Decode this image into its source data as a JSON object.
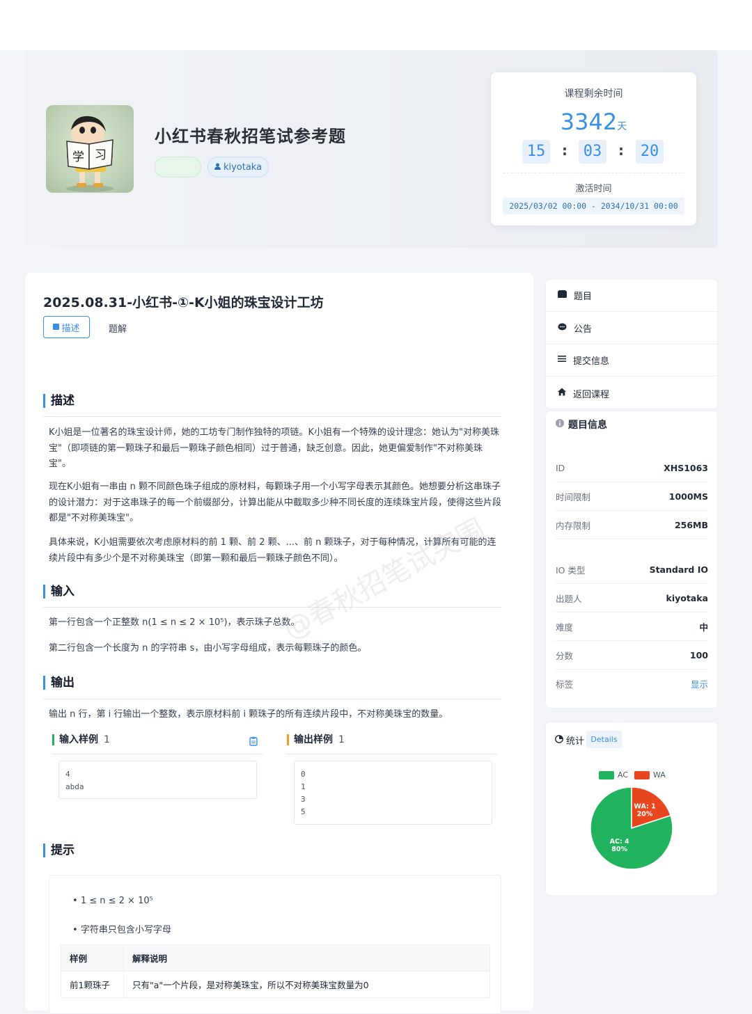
{
  "course": {
    "title": "小红书春秋招笔试参考题",
    "author": "kiyotaka"
  },
  "timer": {
    "label": "课程剩余时间",
    "days": "3342",
    "days_unit": "天",
    "hours": "15",
    "minutes": "03",
    "seconds": "20",
    "activation_label": "激活时间",
    "activation_range": "2025/03/02 00:00 - 2034/10/31 00:00"
  },
  "problem": {
    "title": "2025.08.31-小红书-①-K小姐的珠宝设计工坊",
    "tab_desc": "描述",
    "tab_solution": "题解",
    "sections": {
      "desc": "描述",
      "input": "输入",
      "output": "输出",
      "hint": "提示"
    },
    "desc_paragraphs": [
      "K小姐是一位著名的珠宝设计师，她的工坊专门制作独特的项链。K小姐有一个特殊的设计理念：她认为\"对称美珠宝\"（即项链的第一颗珠子和最后一颗珠子颜色相同）过于普通，缺乏创意。因此，她更偏爱制作\"不对称美珠宝\"。",
      "现在K小姐有一串由 n 颗不同颜色珠子组成的原材料，每颗珠子用一个小写字母表示其颜色。她想要分析这串珠子的设计潜力：对于这串珠子的每一个前缀部分，计算出能从中截取多少种不同长度的连续珠宝片段，使得这些片段都是\"不对称美珠宝\"。",
      "具体来说，K小姐需要依次考虑原材料的前 1 颗、前 2 颗、...、前 n 颗珠子，对于每种情况，计算所有可能的连续片段中有多少个是不对称美珠宝（即第一颗和最后一颗珠子颜色不同）。"
    ],
    "input_paragraphs": [
      "第一行包含一个正整数 n(1 ≤ n ≤ 2 × 10⁵)，表示珠子总数。",
      "第二行包含一个长度为 n 的字符串 s，由小写字母组成，表示每颗珠子的颜色。"
    ],
    "output_paragraph": "输出 n 行，第 i 行输出一个整数，表示原材料前 i 颗珠子的所有连续片段中，不对称美珠宝的数量。",
    "sample_input_label": "输入样例",
    "sample_output_label": "输出样例",
    "sample_index": "1",
    "sample_input": "4\nabda",
    "sample_output": "0\n1\n3\n5",
    "hint_bullets": [
      "1 ≤ n ≤ 2 × 10⁵",
      "字符串只包含小写字母"
    ],
    "hint_table": {
      "headers": [
        "样例",
        "解释说明"
      ],
      "rows": [
        [
          "前1颗珠子",
          "只有\"a\"一个片段，是对称美珠宝，所以不对称美珠宝数量为0"
        ]
      ]
    },
    "watermark": "@春秋招笔试突围"
  },
  "sidebar": {
    "nav": [
      {
        "label": "题目",
        "icon": "book-icon"
      },
      {
        "label": "公告",
        "icon": "chat-icon"
      },
      {
        "label": "提交信息",
        "icon": "list-icon"
      },
      {
        "label": "返回课程",
        "icon": "home-icon"
      }
    ],
    "info_title": "题目信息",
    "info_rows": [
      {
        "k": "ID",
        "v": "XHS1063"
      },
      {
        "k": "时间限制",
        "v": "1000MS"
      },
      {
        "k": "内存限制",
        "v": "256MB"
      },
      {
        "k": "IO 类型",
        "v": "Standard IO"
      },
      {
        "k": "出题人",
        "v": "kiyotaka"
      },
      {
        "k": "难度",
        "v": "中"
      },
      {
        "k": "分数",
        "v": "100"
      },
      {
        "k": "标签",
        "v": "显示"
      }
    ],
    "stats_title": "统计",
    "details_label": "Details"
  },
  "chart_data": {
    "type": "pie",
    "series": [
      {
        "name": "AC",
        "value": 4,
        "percent": "80%",
        "label": "AC: 4",
        "color": "#22b35e"
      },
      {
        "name": "WA",
        "value": 1,
        "percent": "20%",
        "label": "WA: 1",
        "color": "#e8461f"
      }
    ],
    "legend_position": "top"
  },
  "colors": {
    "accent": "#3a8ee6",
    "ac": "#22b35e",
    "wa": "#e8461f"
  }
}
